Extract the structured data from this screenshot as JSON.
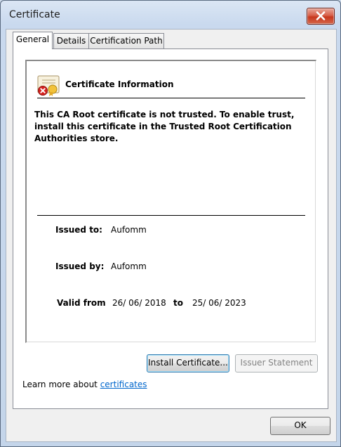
{
  "window": {
    "title": "Certificate"
  },
  "tabs": [
    {
      "label": "General",
      "active": true
    },
    {
      "label": "Details",
      "active": false
    },
    {
      "label": "Certification Path",
      "active": false
    }
  ],
  "cert": {
    "heading": "Certificate Information",
    "message_lines": [
      "This CA Root certificate is not trusted. To enable trust,",
      "install this certificate in the Trusted Root Certification",
      "Authorities store."
    ],
    "issued_to_label": "Issued to:",
    "issued_to_value": "Aufomm",
    "issued_by_label": "Issued by:",
    "issued_by_value": "Aufomm",
    "valid_from_label": "Valid from",
    "valid_from_value": "26/ 06/ 2018",
    "valid_to_label": "to",
    "valid_to_value": "25/ 06/ 2023"
  },
  "buttons": {
    "install": "Install Certificate...",
    "issuer_statement": "Issuer Statement",
    "ok": "OK"
  },
  "learn_more": {
    "prefix": "Learn more about",
    "link": "certificates"
  },
  "icons": {
    "close": "close-icon",
    "certificate": "certificate-error-icon"
  }
}
